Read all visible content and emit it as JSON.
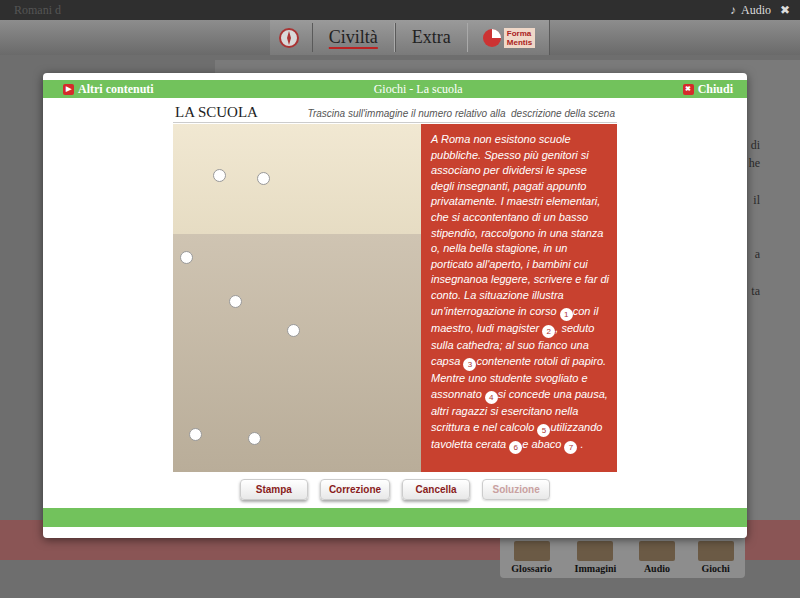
{
  "app_bar": {
    "title": "Romani d",
    "audio_icon": "♪",
    "audio_label": "Audio",
    "close_icon": "✖"
  },
  "nav_tabs": [
    {
      "label": "Civiltà",
      "selected": true
    },
    {
      "label": "Extra",
      "selected": false
    }
  ],
  "logo": {
    "line1": "Forma",
    "line2": "Mentis"
  },
  "background_fragments": [
    "di",
    "he",
    "il",
    "a",
    "ta"
  ],
  "modal": {
    "more_icon": "▶",
    "more_label": "Altri contenuti",
    "title": "Giochi - La scuola",
    "close_icon": "✖",
    "close_label": "Chiudi"
  },
  "exercise": {
    "title": "LA SCUOLA",
    "instruction": "Trascina sull'immagine il numero relativo alla  descrizione della scena"
  },
  "targets": [
    {
      "filled": false
    },
    {
      "filled": false
    },
    {
      "filled": false
    },
    {
      "filled": false
    },
    {
      "filled": false
    },
    {
      "filled": false
    },
    {
      "filled": false
    }
  ],
  "description": {
    "segments": [
      {
        "text": "A Roma non esistono scuole pubbliche. Spesso più genitori si associano per dividersi le spese degli insegnanti, pagati appunto privatamente. I maestri elementari, che si accontentano di un basso stipendio, raccolgono in una stanza o, nella bella stagione, in un porticato all'aperto, i bambini cui insegnanoa leggere, scrivere e far di conto. La situazione illustra un'interrogazione in corso",
        "marker": "1"
      },
      {
        "text": "con il maestro, ludi magister",
        "marker": "2"
      },
      {
        "text": ", seduto sulla cathedra; al suo fianco una capsa",
        "marker": "3"
      },
      {
        "text": "contenente rotoli di papiro. Mentre uno studente svogliato e assonnato",
        "marker": "4"
      },
      {
        "text": "si concede una pausa, altri ragazzi si esercitano nella scrittura e nel calcolo",
        "marker": "5"
      },
      {
        "text": "utilizzando tavoletta cerata",
        "marker": "6"
      },
      {
        "text": "e abaco",
        "marker": "7"
      }
    ],
    "tail": "."
  },
  "buttons": [
    {
      "label": "Stampa",
      "disabled": false
    },
    {
      "label": "Correzione",
      "disabled": false
    },
    {
      "label": "Cancella",
      "disabled": false
    },
    {
      "label": "Soluzione",
      "disabled": true
    }
  ],
  "toolbar": [
    {
      "label": "Glossario"
    },
    {
      "label": "Immagini"
    },
    {
      "label": "Audio"
    },
    {
      "label": "Giochi"
    }
  ]
}
